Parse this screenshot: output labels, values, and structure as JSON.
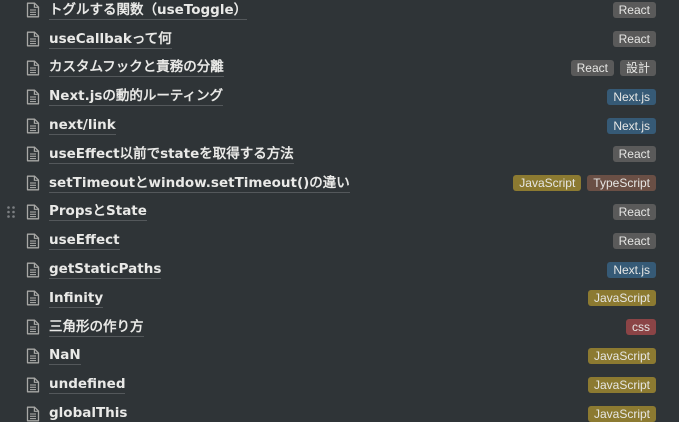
{
  "tag_colors": {
    "React": "#5a5a5a",
    "Next.js": "#365a76",
    "JavaScript": "#8c7a31",
    "TypeScript": "#6a4f45",
    "css": "#8b4446",
    "設計": "#5a5a5a"
  },
  "rows": [
    {
      "title": "トグルする関数（useToggle）",
      "tags": [
        "React"
      ]
    },
    {
      "title": "useCallbakって何",
      "tags": [
        "React"
      ]
    },
    {
      "title": "カスタムフックと責務の分離",
      "tags": [
        "React",
        "設計"
      ]
    },
    {
      "title": "Next.jsの動的ルーティング",
      "tags": [
        "Next.js"
      ]
    },
    {
      "title": "next/link",
      "tags": [
        "Next.js"
      ]
    },
    {
      "title": "useEffect以前でstateを取得する方法",
      "tags": [
        "React"
      ]
    },
    {
      "title": "setTimeoutとwindow.setTimeout()の違い",
      "tags": [
        "JavaScript",
        "TypeScript"
      ]
    },
    {
      "title": "PropsとState",
      "tags": [
        "React"
      ],
      "hover": true
    },
    {
      "title": "useEffect",
      "tags": [
        "React"
      ]
    },
    {
      "title": "getStaticPaths",
      "tags": [
        "Next.js"
      ]
    },
    {
      "title": "Infinity",
      "tags": [
        "JavaScript"
      ]
    },
    {
      "title": "三角形の作り方",
      "tags": [
        "css"
      ]
    },
    {
      "title": "NaN",
      "tags": [
        "JavaScript"
      ]
    },
    {
      "title": "undefined",
      "tags": [
        "JavaScript"
      ]
    },
    {
      "title": "globalThis",
      "tags": [
        "JavaScript"
      ]
    }
  ],
  "icons": {
    "page": "page-icon",
    "drag": "drag-handle-icon"
  }
}
